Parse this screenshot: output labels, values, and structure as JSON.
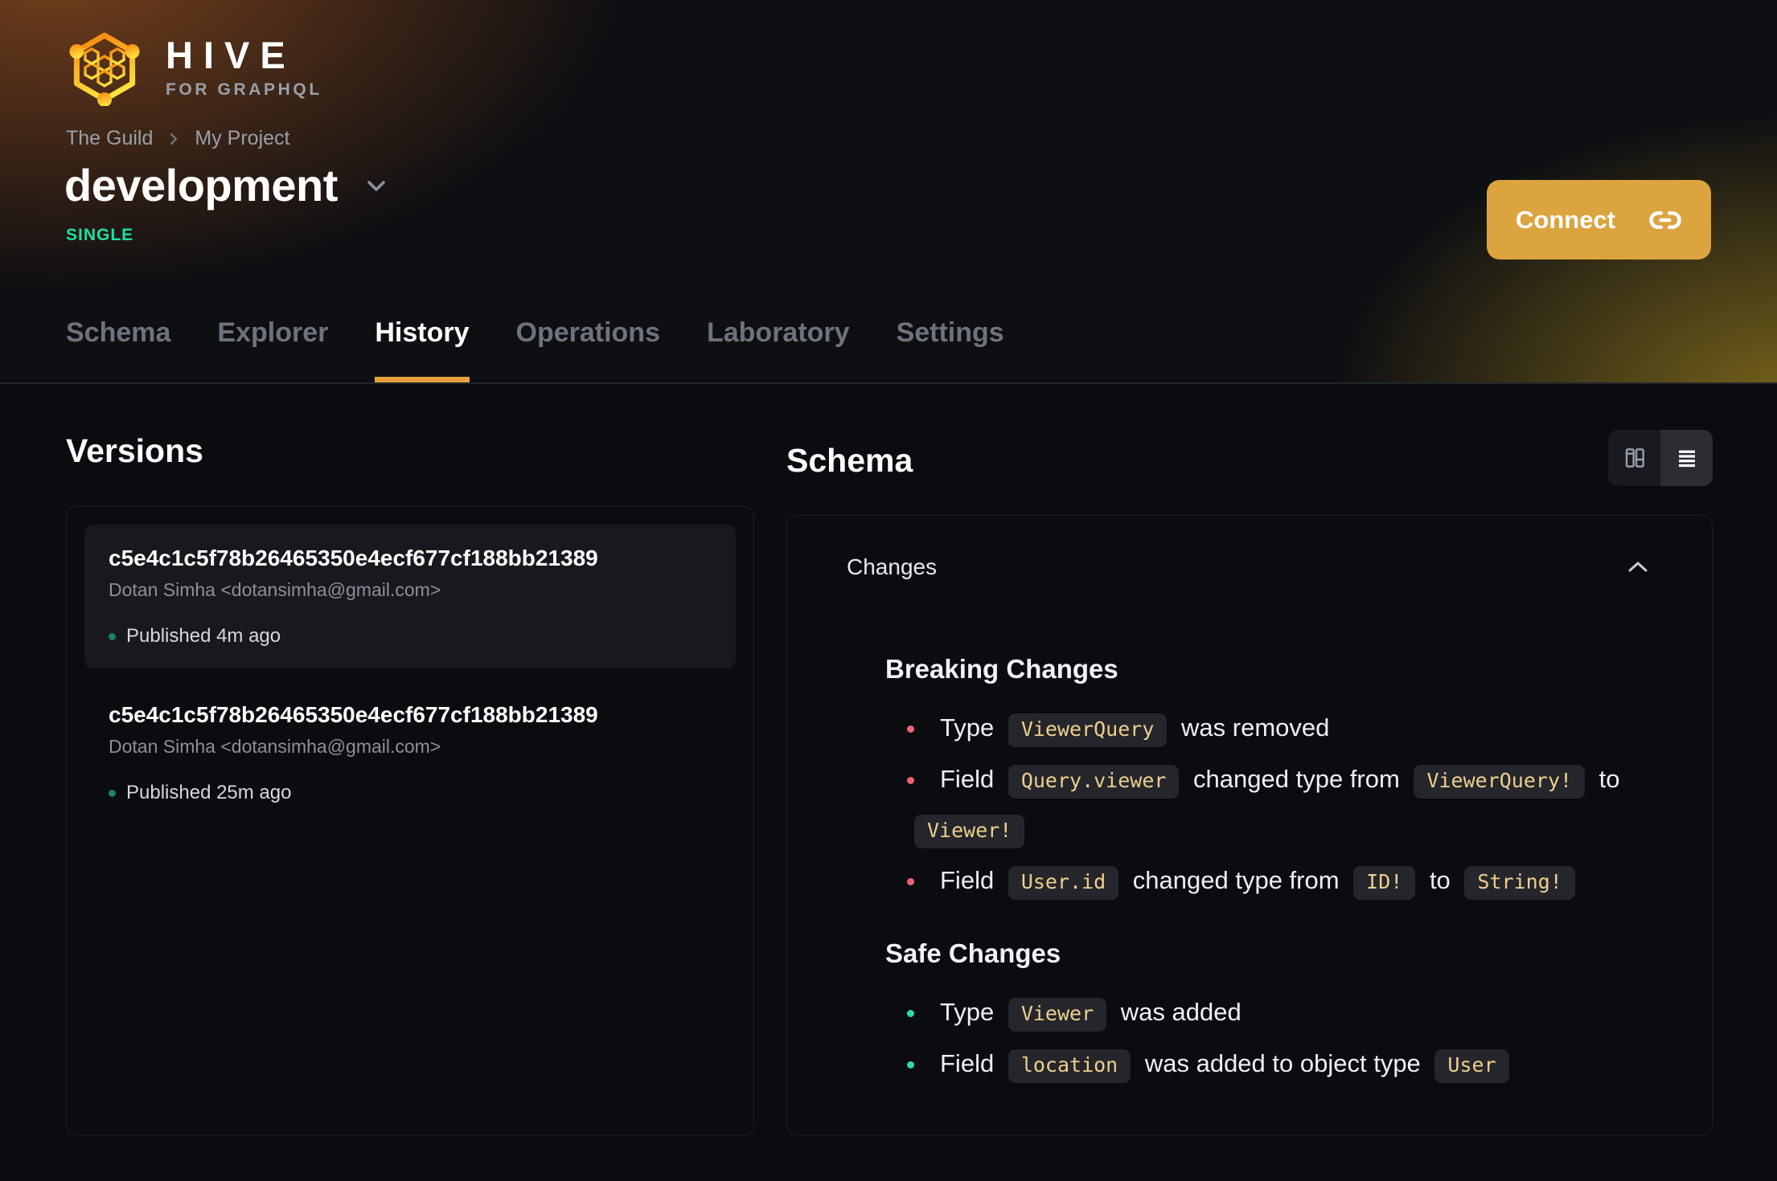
{
  "brand": {
    "name": "HIVE",
    "tagline": "FOR GRAPHQL"
  },
  "breadcrumb": {
    "items": [
      "The Guild",
      "My Project"
    ]
  },
  "target": {
    "name": "development",
    "badge": "SINGLE"
  },
  "connect": {
    "label": "Connect"
  },
  "tabs": [
    {
      "label": "Schema",
      "active": false
    },
    {
      "label": "Explorer",
      "active": false
    },
    {
      "label": "History",
      "active": true
    },
    {
      "label": "Operations",
      "active": false
    },
    {
      "label": "Laboratory",
      "active": false
    },
    {
      "label": "Settings",
      "active": false
    }
  ],
  "versions": {
    "title": "Versions",
    "items": [
      {
        "hash": "c5e4c1c5f78b26465350e4ecf677cf188bb21389",
        "author": "Dotan Simha <dotansimha@gmail.com>",
        "status": "Published 4m ago",
        "selected": true
      },
      {
        "hash": "c5e4c1c5f78b26465350e4ecf677cf188bb21389",
        "author": "Dotan Simha <dotansimha@gmail.com>",
        "status": "Published 25m ago",
        "selected": false
      }
    ]
  },
  "schema_panel": {
    "title": "Schema",
    "view_toggle": {
      "icons": [
        "columns-icon",
        "rows-icon"
      ],
      "selected": "rows-icon"
    },
    "changes": {
      "title": "Changes",
      "collapse_icon": "chevron-up-icon",
      "sections": [
        {
          "title": "Breaking Changes",
          "kind": "breaking",
          "bullet_color": "#ec6375",
          "items": [
            [
              {
                "t": "text",
                "v": "Type "
              },
              {
                "t": "code",
                "v": "ViewerQuery"
              },
              {
                "t": "text",
                "v": " was removed"
              }
            ],
            [
              {
                "t": "text",
                "v": "Field "
              },
              {
                "t": "code",
                "v": "Query.viewer"
              },
              {
                "t": "text",
                "v": " changed type from "
              },
              {
                "t": "code",
                "v": "ViewerQuery!"
              },
              {
                "t": "text",
                "v": " to "
              },
              {
                "t": "code",
                "v": "Viewer!"
              }
            ],
            [
              {
                "t": "text",
                "v": "Field "
              },
              {
                "t": "code",
                "v": "User.id"
              },
              {
                "t": "text",
                "v": " changed type from "
              },
              {
                "t": "code",
                "v": "ID!"
              },
              {
                "t": "text",
                "v": " to "
              },
              {
                "t": "code",
                "v": "String!"
              }
            ]
          ]
        },
        {
          "title": "Safe Changes",
          "kind": "safe",
          "bullet_color": "#2edba4",
          "items": [
            [
              {
                "t": "text",
                "v": "Type "
              },
              {
                "t": "code",
                "v": "Viewer"
              },
              {
                "t": "text",
                "v": " was added"
              }
            ],
            [
              {
                "t": "text",
                "v": "Field "
              },
              {
                "t": "code",
                "v": "location"
              },
              {
                "t": "text",
                "v": " was added to object type "
              },
              {
                "t": "code",
                "v": "User"
              }
            ]
          ]
        }
      ]
    }
  },
  "colors": {
    "accent_yellow": "#e9a23b",
    "connect_button": "#dba43e",
    "badge_green": "#1be1a0",
    "breaking_bullet": "#ec6375",
    "safe_bullet": "#2edba4",
    "chip_text": "#eecf8e"
  }
}
